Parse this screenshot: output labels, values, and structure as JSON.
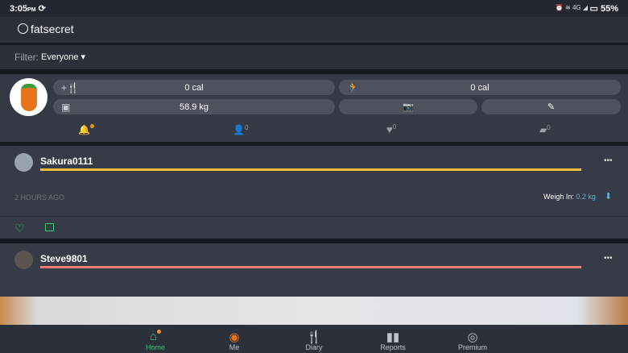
{
  "status_bar": {
    "time": "3:05",
    "ampm": "PM",
    "icons": "⏰ ≋ 4G ◢",
    "battery": "55%"
  },
  "header": {
    "logo": "fatsecret"
  },
  "filter": {
    "label": "Filter:",
    "value": "Everyone"
  },
  "profile": {
    "food_cal": "0 cal",
    "exercise_cal": "0 cal",
    "weight": "58.9 kg",
    "tabs": [
      {
        "name": "notifications",
        "count": ""
      },
      {
        "name": "friends",
        "count": "0"
      },
      {
        "name": "likes",
        "count": "0"
      },
      {
        "name": "comments",
        "count": "0"
      }
    ]
  },
  "posts": [
    {
      "user": "Sakura0111",
      "bar_color": "#f2bf3a",
      "time": "2 HOURS AGO",
      "weigh_label": "Weigh In:",
      "weigh_value": "0.2 kg"
    },
    {
      "user": "Steve9801",
      "bar_color": "#f07c74"
    }
  ],
  "bottom_nav": [
    {
      "label": "Home"
    },
    {
      "label": "Me"
    },
    {
      "label": "Diary"
    },
    {
      "label": "Reports"
    },
    {
      "label": "Premium"
    }
  ],
  "colors": {
    "accent": "#2ecc71",
    "notify": "#f0932b",
    "link": "#5ab4d6"
  }
}
